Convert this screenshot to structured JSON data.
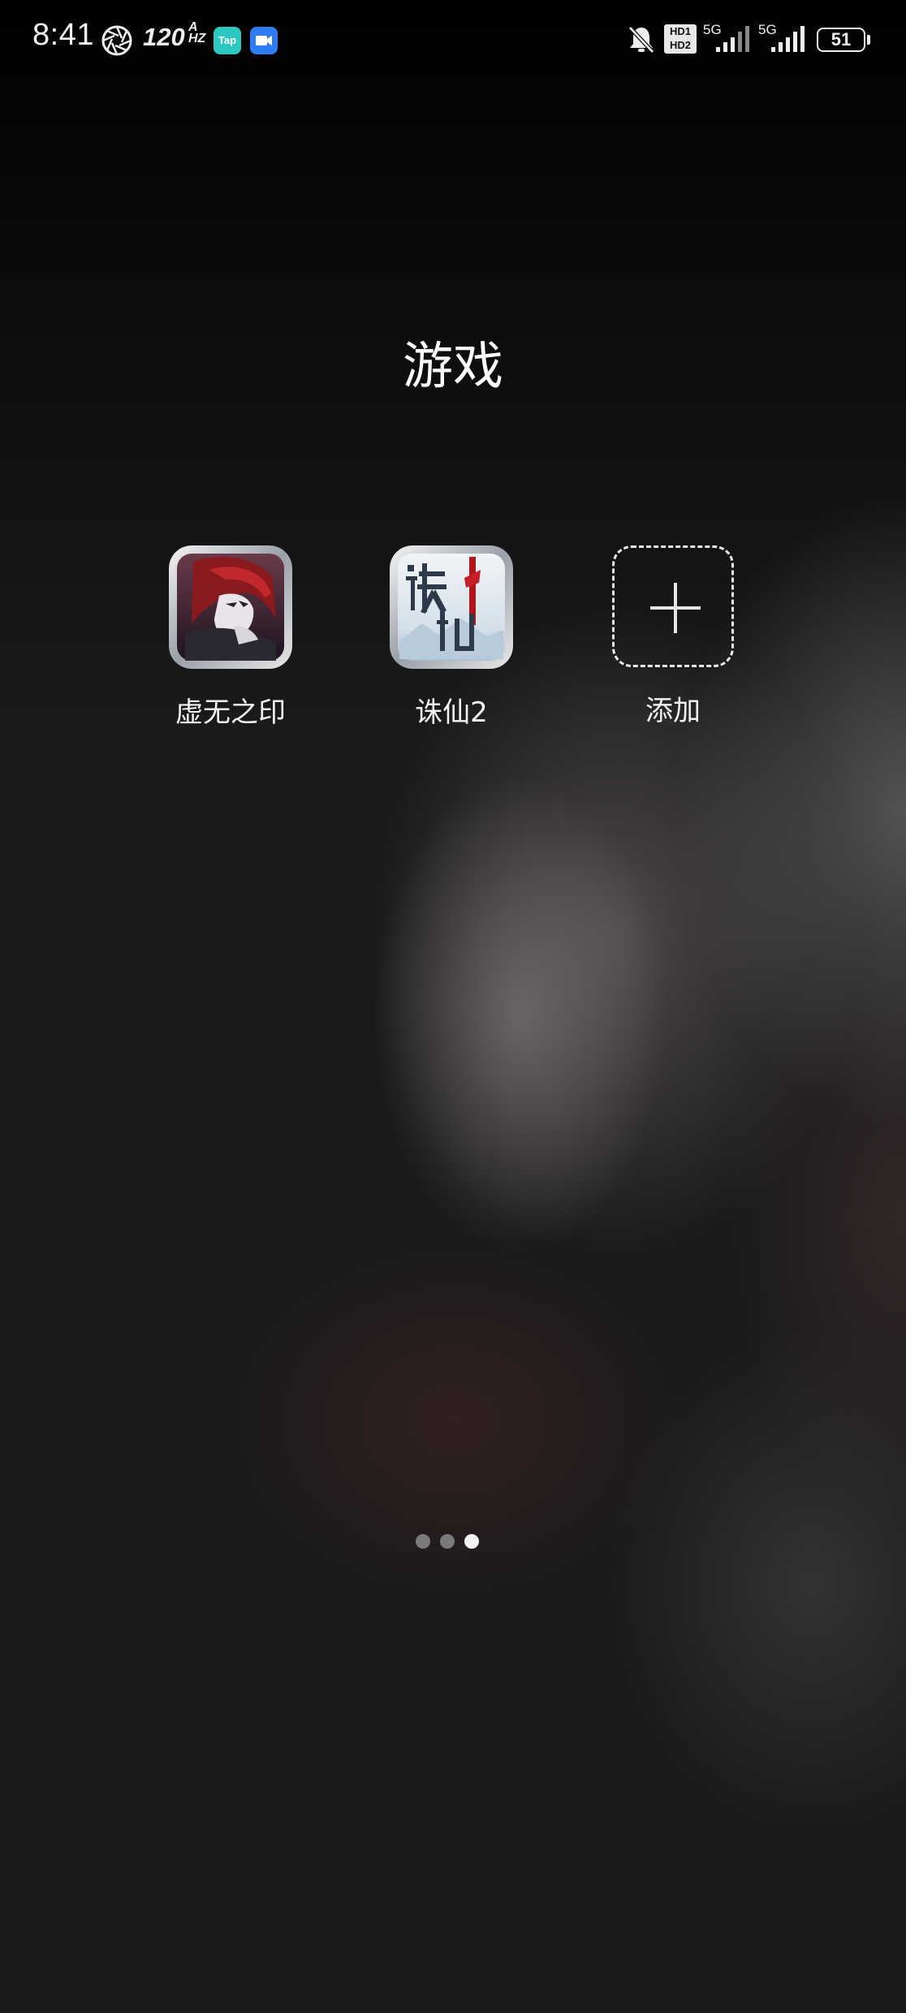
{
  "status_bar": {
    "time": "8:41",
    "refresh_rate": "120",
    "refresh_unit": "HZ",
    "refresh_mode": "A",
    "tap_badge": "Tap",
    "hd1": "HD1",
    "hd2": "HD2",
    "sim1_network": "5G",
    "sim2_network": "5G",
    "battery_level": "51"
  },
  "folder": {
    "title": "游戏",
    "apps": [
      {
        "label": "虚无之印",
        "icon": "xuwuzhiyin-game-icon"
      },
      {
        "label": "诛仙2",
        "icon": "zhuxian2-game-icon"
      }
    ],
    "add_label": "添加"
  },
  "pagination": {
    "total": 3,
    "current": 3
  }
}
